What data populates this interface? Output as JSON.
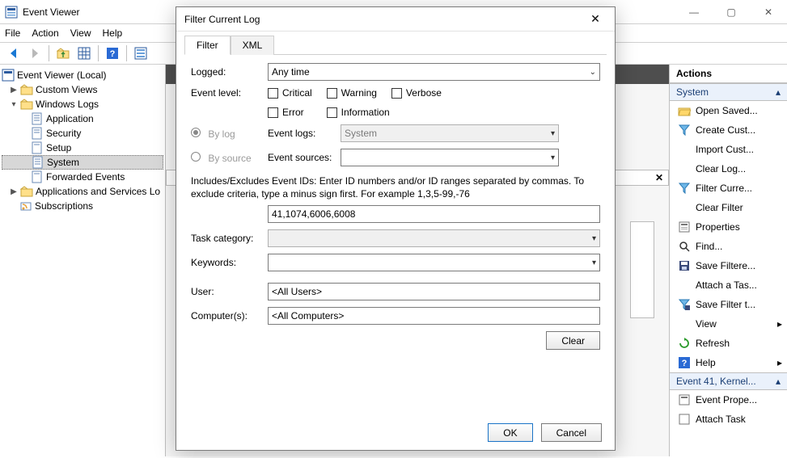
{
  "window": {
    "title": "Event Viewer",
    "controls": {
      "minimize": "—",
      "maximize": "▢",
      "close": "✕"
    }
  },
  "menu": [
    "File",
    "Action",
    "View",
    "Help"
  ],
  "tree": {
    "root": "Event Viewer (Local)",
    "items": [
      {
        "label": "Custom Views"
      },
      {
        "label": "Windows Logs",
        "children": [
          {
            "label": "Application"
          },
          {
            "label": "Security"
          },
          {
            "label": "Setup"
          },
          {
            "label": "System"
          },
          {
            "label": "Forwarded Events"
          }
        ]
      },
      {
        "label": "Applications and Services Lo"
      },
      {
        "label": "Subscriptions"
      }
    ]
  },
  "actions": {
    "header": "Actions",
    "group1_title": "System",
    "group1": [
      "Open Saved...",
      "Create Cust...",
      "Import Cust...",
      "Clear Log...",
      "Filter Curre...",
      "Clear Filter",
      "Properties",
      "Find...",
      "Save Filtere...",
      "Attach a Tas...",
      "Save Filter t...",
      "View",
      "Refresh",
      "Help"
    ],
    "group2_title": "Event 41, Kernel...",
    "group2": [
      "Event Prope...",
      "Attach Task"
    ]
  },
  "dialog": {
    "title": "Filter Current Log",
    "tabs": {
      "filter": "Filter",
      "xml": "XML"
    },
    "labels": {
      "logged": "Logged:",
      "event_level": "Event level:",
      "by_log": "By log",
      "by_source": "By source",
      "event_logs": "Event logs:",
      "event_sources": "Event sources:",
      "task_category": "Task category:",
      "keywords": "Keywords:",
      "user": "User:",
      "computers": "Computer(s):"
    },
    "logged_value": "Any time",
    "event_levels": {
      "critical": "Critical",
      "warning": "Warning",
      "verbose": "Verbose",
      "error": "Error",
      "information": "Information"
    },
    "event_logs_value": "System",
    "event_sources_value": "",
    "hint": "Includes/Excludes Event IDs: Enter ID numbers and/or ID ranges separated by commas. To exclude criteria, type a minus sign first. For example 1,3,5-99,-76",
    "event_ids_value": "41,1074,6006,6008",
    "task_category_value": "",
    "keywords_value": "",
    "user_value": "<All Users>",
    "computers_value": "<All Computers>",
    "buttons": {
      "clear": "Clear",
      "ok": "OK",
      "cancel": "Cancel"
    }
  }
}
